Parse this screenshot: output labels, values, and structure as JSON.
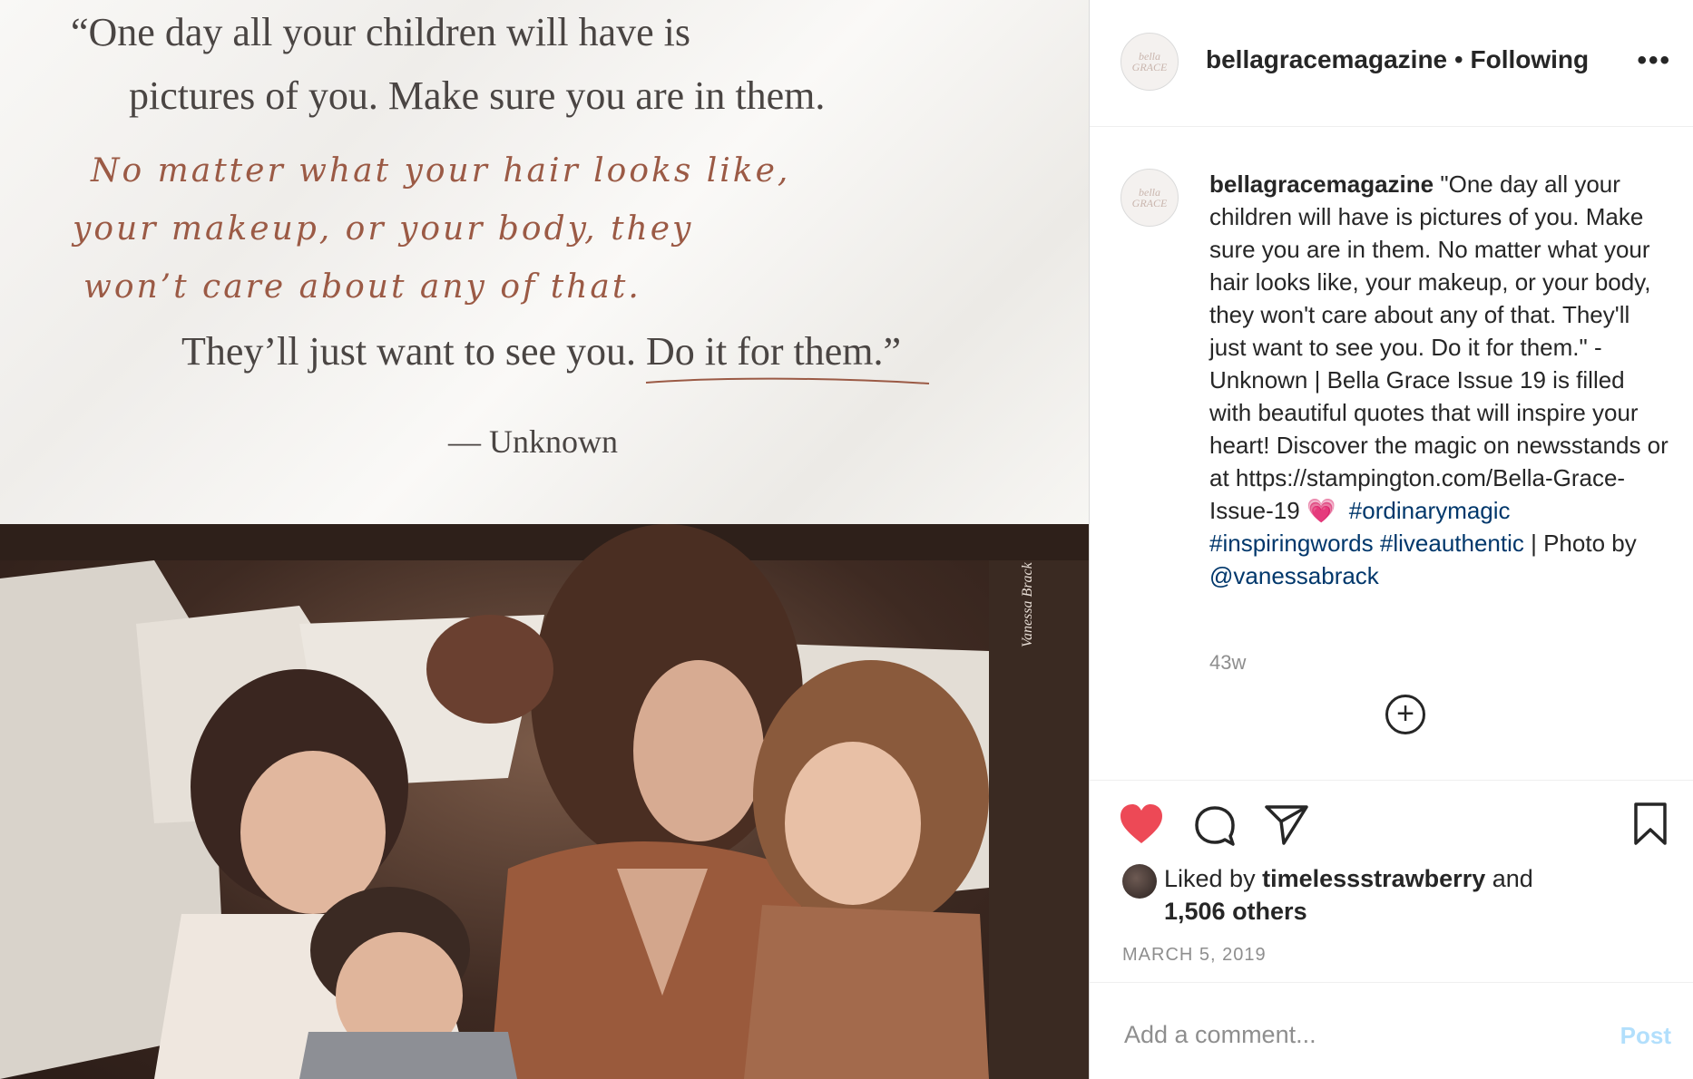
{
  "post_image": {
    "quote_line1": "“One day all your children will have is",
    "quote_line2": "pictures of you. Make sure you are in them.",
    "script_line1": "No matter what your hair looks like,",
    "script_line2": "your makeup, or your body, they",
    "script_line3": "won’t care about any of that.",
    "quote_line3": "They’ll just want to see you. Do it for them.”",
    "attribution": "— Unknown",
    "photo_credit": "Vanessa Brack"
  },
  "header": {
    "avatar_text": "bella GRACE",
    "username": "bellagracemagazine",
    "separator": "•",
    "follow_state": "Following",
    "more": "•••"
  },
  "caption": {
    "avatar_text": "bella GRACE",
    "username": "bellagracemagazine",
    "text": "\"One day all your children will have is pictures of you. Make sure you are in them. No matter what your hair looks like, your makeup, or your body, they won't care about any of that. They'll just want to see you. Do it for them.\" - Unknown | Bella Grace Issue 19 is filled with beautiful quotes that will inspire your heart! Discover the magic on newsstands or at https://stampington.com/Bella-Grace-Issue-19",
    "emoji": "💗",
    "hashtags": [
      "#ordinarymagic",
      "#inspiringwords",
      "#liveauthentic"
    ],
    "photo_prefix": " | Photo by ",
    "mention": "@vanessabrack",
    "time_ago": "43w"
  },
  "load_more": "+",
  "actions": {
    "like_color": "#ed4956"
  },
  "likes": {
    "prefix": "Liked by ",
    "user": "timelessstrawberry",
    "middle": " and",
    "others": "1,506 others"
  },
  "date": "MARCH 5, 2019",
  "comment": {
    "placeholder": "Add a comment...",
    "post_label": "Post"
  }
}
